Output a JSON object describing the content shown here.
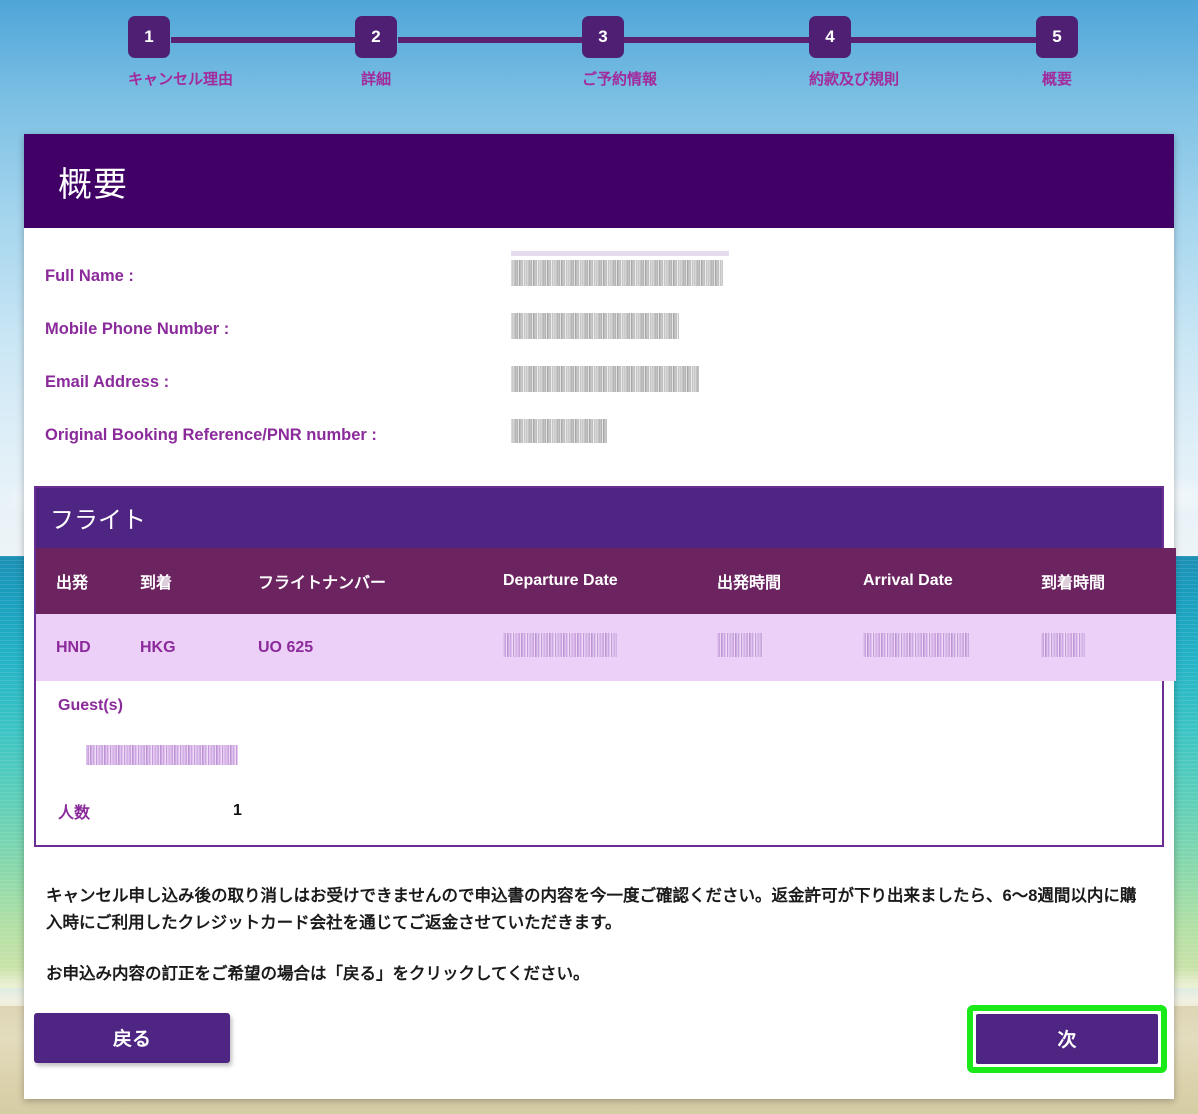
{
  "stepper": {
    "steps": [
      {
        "number": "1",
        "label": "キャンセル理由"
      },
      {
        "number": "2",
        "label": "詳細"
      },
      {
        "number": "3",
        "label": "ご予約情報"
      },
      {
        "number": "4",
        "label": "約款及び規則"
      },
      {
        "number": "5",
        "label": "概要"
      }
    ],
    "active_color": "#4f1f73",
    "label_color": "#a32a9c"
  },
  "card": {
    "title": "概要",
    "header_color": "#400066"
  },
  "summary_fields": [
    {
      "label": "Full Name :",
      "value": ""
    },
    {
      "label": "Mobile Phone Number :",
      "value": ""
    },
    {
      "label": "Email Address :",
      "value": ""
    },
    {
      "label": "Original Booking Reference/PNR number :",
      "value": ""
    }
  ],
  "flight": {
    "panel_title": "フライト",
    "panel_title_color": "#4f2583",
    "header_color": "#6b2460",
    "row_color": "#edd0f7",
    "columns": [
      "出発",
      "到着",
      "フライトナンバー",
      "Departure Date",
      "出発時間",
      "Arrival Date",
      "到着時間"
    ],
    "rows": [
      {
        "departure": "HND",
        "arrival": "HKG",
        "flight_number": "UO 625",
        "departure_date": "",
        "departure_time": "",
        "arrival_date": "",
        "arrival_time": ""
      }
    ]
  },
  "guests": {
    "title": "Guest(s)",
    "names": [
      ""
    ],
    "pax_label": "人数",
    "pax_value": "1"
  },
  "notices": {
    "first_part_a": "キャンセル申し込み後の取り消しはお受けできませんので申込書の内容を今一度ご確認ください。返金許可が下り出来ましたら、",
    "first_part_b": "6〜8週間以内",
    "first_part_c": "に購入時にご利用したクレジットカード会社を通じてご返金させていただきます。",
    "second": "お申込み内容の訂正をご希望の場合は「戻る」をクリックしてください。"
  },
  "footer": {
    "back_label": "戻る",
    "next_label": "次",
    "button_color": "#4f2583",
    "highlight_color": "#1aeb18"
  }
}
